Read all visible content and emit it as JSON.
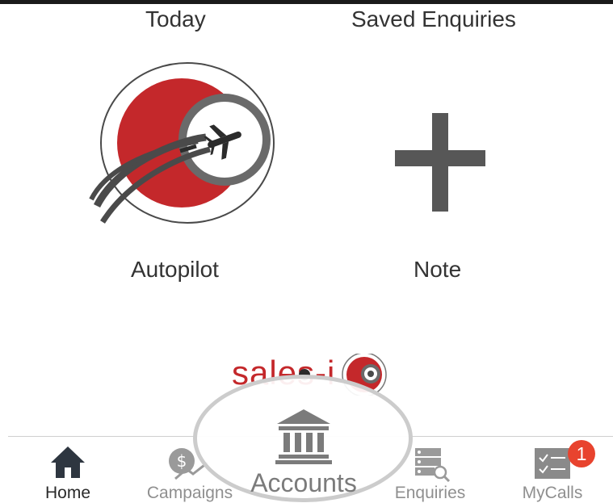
{
  "grid": {
    "today_label": "Today",
    "saved_enquiries_label": "Saved Enquiries",
    "autopilot_label": "Autopilot",
    "note_label": "Note"
  },
  "bottom_logo": {
    "text": "sales-i"
  },
  "tabbar": {
    "tabs": [
      {
        "label": "Home",
        "icon": "home-icon",
        "active": true
      },
      {
        "label": "Campaigns",
        "icon": "campaigns-icon",
        "active": false
      },
      {
        "label": "Accounts",
        "icon": "bank-icon",
        "active": false
      },
      {
        "label": "Enquiries",
        "icon": "enquiries-icon",
        "active": false
      },
      {
        "label": "MyCalls",
        "icon": "mycalls-icon",
        "active": false
      }
    ],
    "mycalls_badge": "1"
  },
  "colors": {
    "brand_red": "#c4282b",
    "badge_red": "#e8432e",
    "icon_grey": "#575757"
  }
}
